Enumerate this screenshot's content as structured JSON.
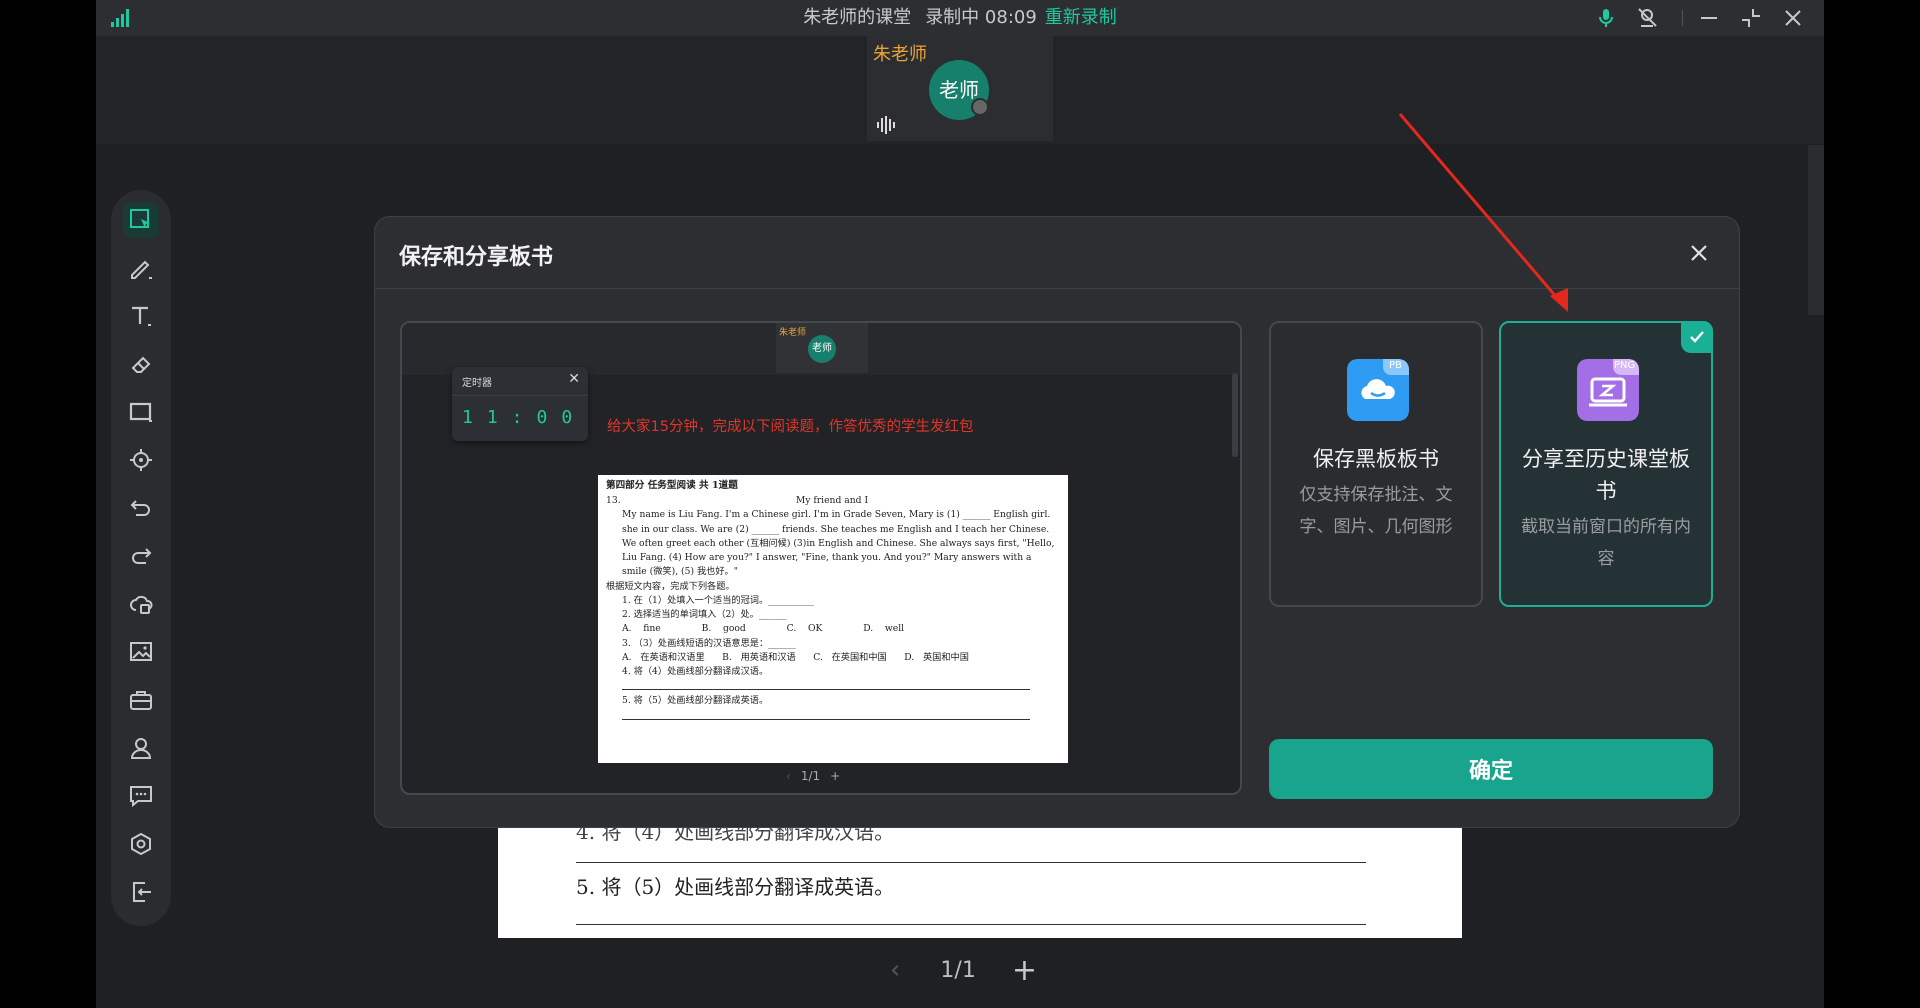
{
  "titlebar": {
    "classroom": "朱老师的课堂",
    "recording_status": "录制中 08:09",
    "rerecord_link": "重新录制"
  },
  "video": {
    "teacher_name": "朱老师",
    "avatar_label": "老师"
  },
  "toolbar": {
    "tools": [
      "select-icon",
      "pen-icon",
      "text-icon",
      "eraser-icon",
      "rectangle-icon",
      "laser-pointer-icon",
      "undo-icon",
      "redo-icon",
      "cloud-disk-icon",
      "image-icon",
      "toolbox-icon",
      "user-icon",
      "chat-icon",
      "settings-icon",
      "exit-icon"
    ]
  },
  "background_doc": {
    "line_partial": "4.  将（4）处画线部分翻译成汉语。",
    "line_q5": "5.  将（5）处画线部分翻译成英语。"
  },
  "page_nav": {
    "prev": "‹",
    "page": "1/1",
    "add": "+"
  },
  "modal": {
    "title": "保存和分享板书",
    "preview": {
      "teacher_name": "朱老师",
      "avatar_label": "老师",
      "timer_title": "定时器",
      "timer_close": "✕",
      "timer_digits": "11:00",
      "notice": "给大家15分钟，完成以下阅读题，作答优秀的学生发红包",
      "doc": {
        "header": "第四部分  任务型阅读  共 1道题",
        "qnum": "13.",
        "passage_title": "My friend and I",
        "p1": "My name is Liu Fang. I'm a Chinese girl. I'm in Grade Seven, Mary is (1) ______ English girl. she in our class. We are (2) ______ friends. She teaches me English and I teach her Chinese. We often greet each other (互相问候) (3)in English and Chinese. She always says first, \"Hello, Liu Fang. (4) How are you?\" I answer, \"Fine, thank you. And you?\" Mary answers with a smile (微笑), (5) 我也好。\"",
        "instruction": "根据短文内容，完成下列各题。",
        "q1": "1.  在（1）处填入一个适当的冠词。__________",
        "q2": "2.  选择适当的单词填入（2）处。______",
        "q2_options": "A.    fine              B.    good              C.    OK              D.    well",
        "q3": "3.  （3）处画线短语的汉语意思是：______",
        "q3_options": "A.   在英语和汉语里      B.   用英语和汉语      C.   在英国和中国      D.   英国和中国",
        "q4": "4.  将（4）处画线部分翻译成汉语。",
        "q5": "5.  将（5）处画线部分翻译成英语。"
      },
      "nav_prev": "‹",
      "nav_page": "1/1",
      "nav_add": "+"
    },
    "option_save": {
      "badge": "PB",
      "title": "保存黑板板书",
      "desc": "仅支持保存批注、文字、图片、几何图形"
    },
    "option_share": {
      "badge": "PNG",
      "title": "分享至历史课堂板书",
      "desc": "截取当前窗口的所有内容"
    },
    "confirm_label": "确定"
  },
  "colors": {
    "accent": "#19a48d",
    "notice_red": "#e0352b",
    "teacher_orange": "#e8a33a",
    "arrow_red": "#e4281e"
  }
}
